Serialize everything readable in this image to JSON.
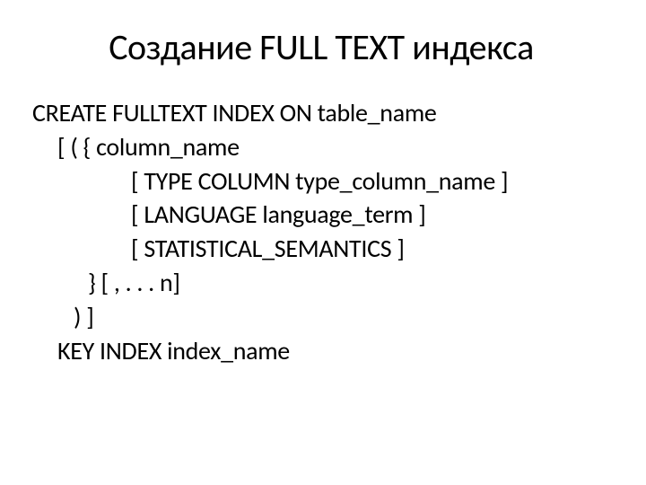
{
  "slide": {
    "title": "Создание FULL TEXT индекса",
    "body": {
      "line1": "CREATE FULLTEXT INDEX ON table_name",
      "line2": "[ ( { column_name",
      "line3": "[ TYPE COLUMN type_column_name ]",
      "line4": "[ LANGUAGE language_term ]",
      "line5": "[ STATISTICAL_SEMANTICS ]",
      "line6": "} [ , . . . n]",
      "line7": ") ]",
      "line8": "KEY INDEX index_name"
    }
  }
}
